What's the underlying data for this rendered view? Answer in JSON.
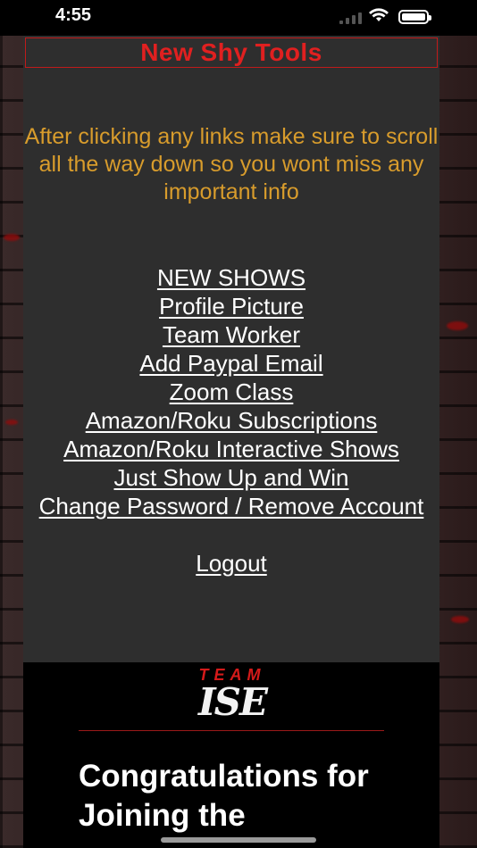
{
  "status_bar": {
    "time": "4:55"
  },
  "header": {
    "title": "New Shy Tools"
  },
  "notice": "After clicking any links make sure to scroll all the way down so you wont miss any important info",
  "links": [
    {
      "label": "NEW SHOWS"
    },
    {
      "label": "Profile Picture"
    },
    {
      "label": "Team Worker"
    },
    {
      "label": "Add Paypal Email"
    },
    {
      "label": "Zoom Class"
    },
    {
      "label": "Amazon/Roku Subscriptions"
    },
    {
      "label": "Amazon/Roku Interactive Shows"
    },
    {
      "label": "Just Show Up and Win"
    },
    {
      "label": "Change Password / Remove Account"
    }
  ],
  "logout_label": "Logout",
  "logo": {
    "top": "TEAM",
    "bottom": "ISE"
  },
  "footer": {
    "headline": "Congratulations for Joining the"
  },
  "colors": {
    "title": "#e02020",
    "notice": "#d89c2c",
    "panel": "#2e2e2e"
  }
}
